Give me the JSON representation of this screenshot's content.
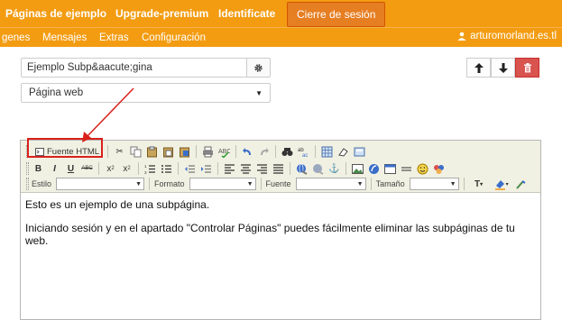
{
  "topnav": {
    "items": [
      "Páginas de ejemplo",
      "Upgrade-premium",
      "Identificate"
    ],
    "active": "Cierre de sesión"
  },
  "subnav": {
    "items": [
      "genes",
      "Mensajes",
      "Extras",
      "Configuración"
    ],
    "user": "arturomorland.es.tl"
  },
  "form": {
    "page_name": "Ejemplo Subp&aacute;gina",
    "page_type": "Página web"
  },
  "editor": {
    "source_label": "Fuente HTML",
    "style_label": "Estilo",
    "format_label": "Formato",
    "font_label": "Fuente",
    "size_label": "Tamaño",
    "paragraphs": [
      "Esto es un ejemplo de una subpágina.",
      "Iniciando sesión y en el apartado \"Controlar Páginas\" puedes fácilmente eliminar las subpáginas de tu web."
    ]
  },
  "colors": {
    "brand": "#f39c12",
    "active": "#e67e22",
    "danger": "#d9534f",
    "highlight": "#d9211d"
  }
}
